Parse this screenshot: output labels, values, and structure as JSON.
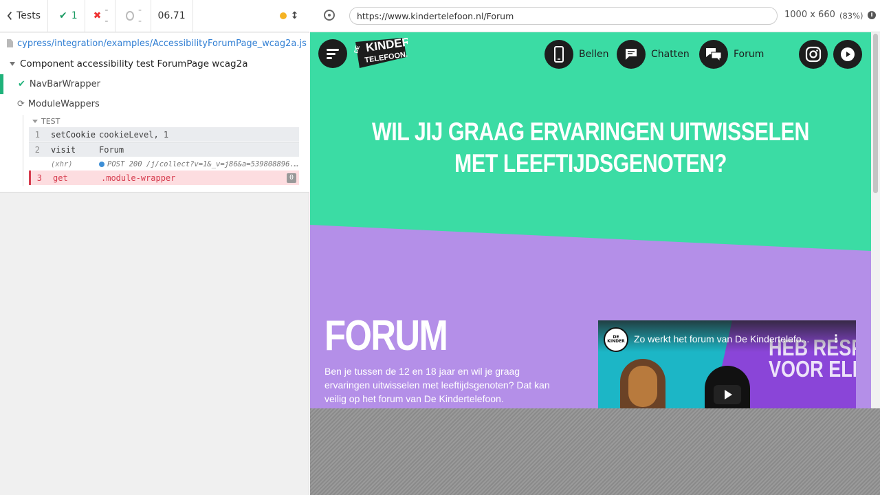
{
  "reporter": {
    "tests_label": "Tests",
    "passed": "1",
    "failed": "--",
    "pending": "--",
    "duration": "06.71",
    "spec_path": "cypress/integration/examples/AccessibilityForumPage_wcag2a.js",
    "suite_title": "Component accessibility test ForumPage wcag2a",
    "tests": [
      {
        "title": "NavBarWrapper",
        "state": "passed"
      },
      {
        "title": "ModuleWappers",
        "state": "running"
      }
    ],
    "test_section_label": "TEST",
    "commands": [
      {
        "num": "1",
        "name": "setCookie",
        "message": "cookieLevel, 1"
      },
      {
        "num": "2",
        "name": "visit",
        "message": "Forum"
      },
      {
        "num": "",
        "name": "(xhr)",
        "message": "POST 200 /j/collect?v=1&_v=j86&a=539808896..."
      },
      {
        "num": "3",
        "name": "get",
        "message": ".module-wrapper",
        "count": "0"
      }
    ],
    "colors": {
      "pass": "#1fb27a",
      "fail": "#d63c4e",
      "running": "#f5b324"
    }
  },
  "aut": {
    "url": "https://www.kindertelefoon.nl/Forum",
    "viewport": "1000 x 660",
    "zoom": "(83%)",
    "info": "i"
  },
  "site": {
    "logo_text": [
      "DE",
      "KINDER",
      "TELEFOON.NL"
    ],
    "nav": [
      {
        "label": "Bellen",
        "icon": "phone-icon"
      },
      {
        "label": "Chatten",
        "icon": "chat-icon"
      },
      {
        "label": "Forum",
        "icon": "forum-icon"
      }
    ],
    "socials": [
      "instagram-icon",
      "youtube-icon"
    ],
    "hero_line1": "WIL JIJ GRAAG ERVARINGEN UITWISSELEN",
    "hero_line2": "MET LEEFTIJDSGENOTEN?",
    "forum_title": "FORUM",
    "forum_text": "Ben je tussen de 12 en 18 jaar en wil je graag ervaringen uitwisselen met leeftijdsgenoten? Dat kan veilig op het forum van De Kindertelefoon.",
    "video_title": "Zo werkt het forum van De Kindertelefo...",
    "video_overlay_line1": "HEB RESPEC",
    "video_overlay_line2": "VOOR ELKAA",
    "colors": {
      "green": "#3bdca4",
      "purple": "#b48fe8",
      "dark": "#1d1d1d"
    }
  }
}
